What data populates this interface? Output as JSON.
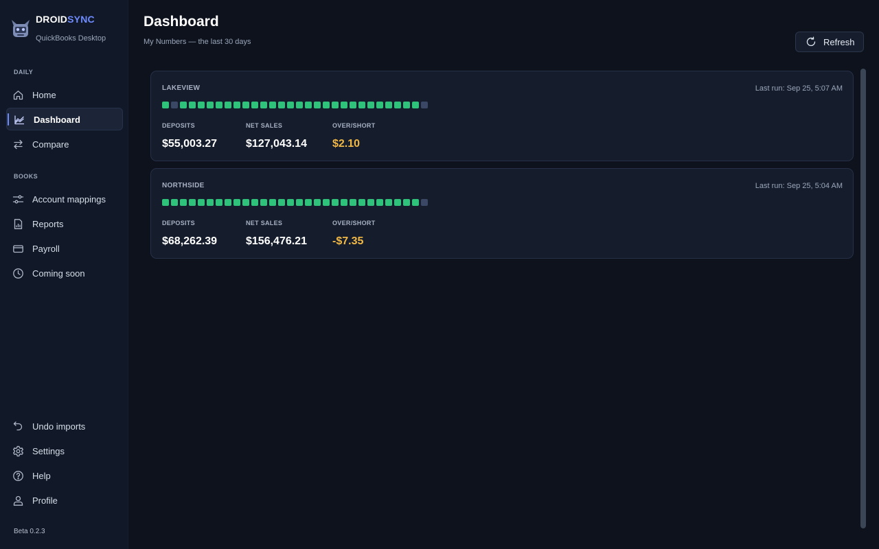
{
  "brand": {
    "name_primary": "DROID",
    "name_accent": "SYNC",
    "subtitle": "QuickBooks Desktop",
    "accent_color": "#6f8cff"
  },
  "sidebar": {
    "sections": {
      "daily": "DAILY",
      "books": "BOOKS"
    },
    "items": [
      {
        "label": "Home",
        "icon": "home-icon"
      },
      {
        "label": "Dashboard",
        "icon": "chart-icon",
        "active": true
      },
      {
        "label": "Compare",
        "icon": "swap-icon"
      },
      {
        "label": "Account mappings",
        "icon": "sliders-icon"
      },
      {
        "label": "Reports",
        "icon": "report-icon"
      },
      {
        "label": "Payroll",
        "icon": "card-icon"
      },
      {
        "label": "Coming soon",
        "icon": "clock-icon"
      },
      {
        "label": "Undo imports",
        "icon": "undo-icon"
      },
      {
        "label": "Settings",
        "icon": "gear-icon"
      },
      {
        "label": "Help",
        "icon": "help-icon"
      },
      {
        "label": "Profile",
        "icon": "user-icon"
      }
    ],
    "version": "Beta 0.2.3"
  },
  "header": {
    "title": "Dashboard",
    "subtitle": "My Numbers — the last 30 days",
    "refresh_label": "Refresh"
  },
  "colors": {
    "status_ok": "#2fc27a",
    "status_missing": "#3a4865",
    "over_short": "#f1b845"
  },
  "stores": [
    {
      "name": "LAKEVIEW",
      "last_run": "Last run: Sep 25, 5:07 AM",
      "days": [
        1,
        0,
        1,
        1,
        1,
        1,
        1,
        1,
        1,
        1,
        1,
        1,
        1,
        1,
        1,
        1,
        1,
        1,
        1,
        1,
        1,
        1,
        1,
        1,
        1,
        1,
        1,
        1,
        1,
        0
      ],
      "stats": {
        "deposits_label": "DEPOSITS",
        "deposits": "$55,003.27",
        "net_sales_label": "NET SALES",
        "net_sales": "$127,043.14",
        "over_short_label": "OVER/SHORT",
        "over_short": "$2.10"
      }
    },
    {
      "name": "NORTHSIDE",
      "last_run": "Last run: Sep 25, 5:04 AM",
      "days": [
        1,
        1,
        1,
        1,
        1,
        1,
        1,
        1,
        1,
        1,
        1,
        1,
        1,
        1,
        1,
        1,
        1,
        1,
        1,
        1,
        1,
        1,
        1,
        1,
        1,
        1,
        1,
        1,
        1,
        0
      ],
      "stats": {
        "deposits_label": "DEPOSITS",
        "deposits": "$68,262.39",
        "net_sales_label": "NET SALES",
        "net_sales": "$156,476.21",
        "over_short_label": "OVER/SHORT",
        "over_short": "-$7.35"
      }
    }
  ]
}
